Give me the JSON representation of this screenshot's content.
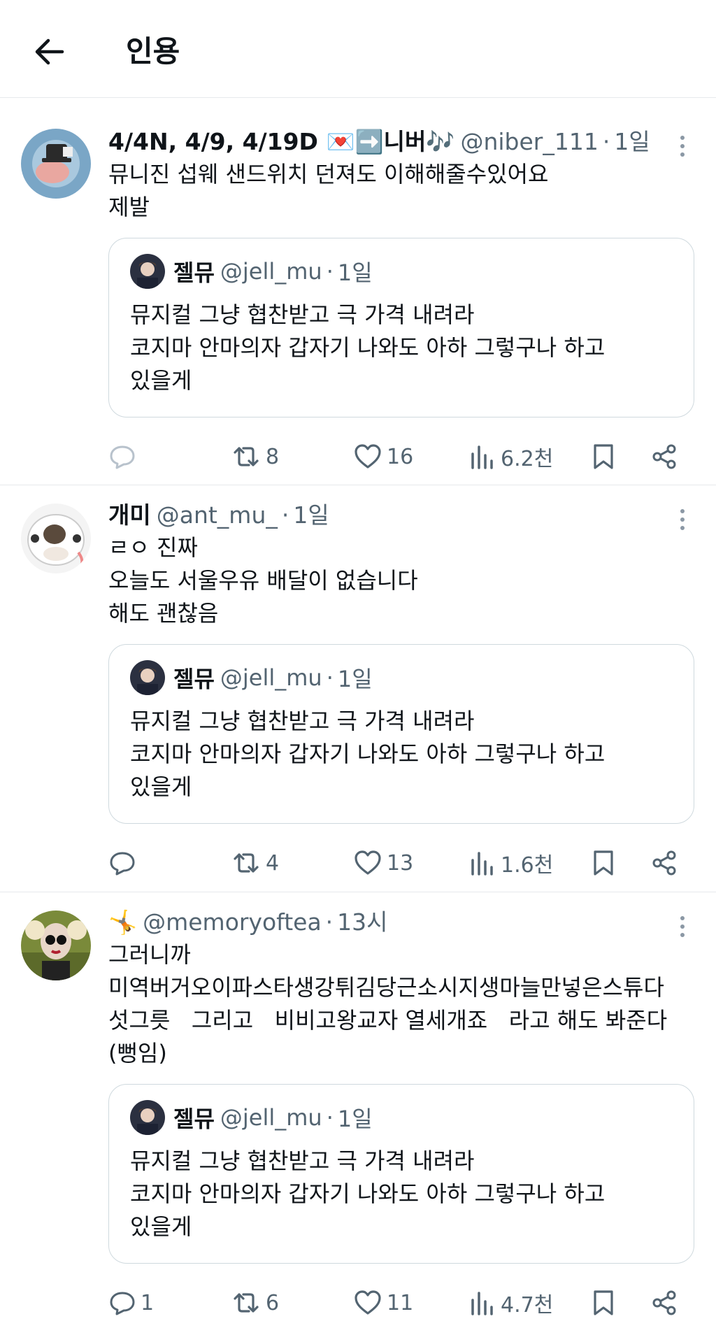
{
  "header": {
    "title": "인용",
    "back_icon": "arrow-left-icon"
  },
  "tweets": [
    {
      "display_name": "4/4N, 4/9, 4/19D 💌➡️니버🎶",
      "handle": "@niber_111",
      "time": "1일",
      "text": "뮤니진 섭웨 샌드위치 던져도 이해해줄수있어요\n제발",
      "quote": {
        "display_name": "젤뮤",
        "handle": "@jell_mu",
        "time": "1일",
        "text": "뮤지컬 그냥 협찬받고 극 가격 내려라\n코지마 안마의자 갑자기 나와도 아하 그렇구나 하고\n있을게"
      },
      "reply_count": "",
      "retweet_count": "8",
      "like_count": "16",
      "view_count": "6.2천"
    },
    {
      "display_name": "개미",
      "handle": "@ant_mu_",
      "time": "1일",
      "text": "ㄹㅇ 진짜\n오늘도 서울우유 배달이 없습니다\n해도 괜찮음",
      "quote": {
        "display_name": "젤뮤",
        "handle": "@jell_mu",
        "time": "1일",
        "text": "뮤지컬 그냥 협찬받고 극 가격 내려라\n코지마 안마의자 갑자기 나와도 아하 그렇구나 하고\n있을게"
      },
      "reply_count": "",
      "retweet_count": "4",
      "like_count": "13",
      "view_count": "1.6천"
    },
    {
      "display_name": "🤸",
      "handle": "@memoryoftea",
      "time": "13시",
      "text": "그러니까\n미역버거오이파스타생강튀김당근소시지생마늘만넣은스튜다\n섯그릇   그리고   비비고왕교자 열세개죠   라고 해도 봐준다\n(뻥임)",
      "quote": {
        "display_name": "젤뮤",
        "handle": "@jell_mu",
        "time": "1일",
        "text": "뮤지컬 그냥 협찬받고 극 가격 내려라\n코지마 안마의자 갑자기 나와도 아하 그렇구나 하고\n있을게"
      },
      "reply_count": "1",
      "retweet_count": "6",
      "like_count": "11",
      "view_count": "4.7천"
    }
  ],
  "separator": "·",
  "colors": {
    "text": "#0f1419",
    "muted": "#536471",
    "border": "#cfd9de",
    "divider": "#e6e9ec"
  }
}
